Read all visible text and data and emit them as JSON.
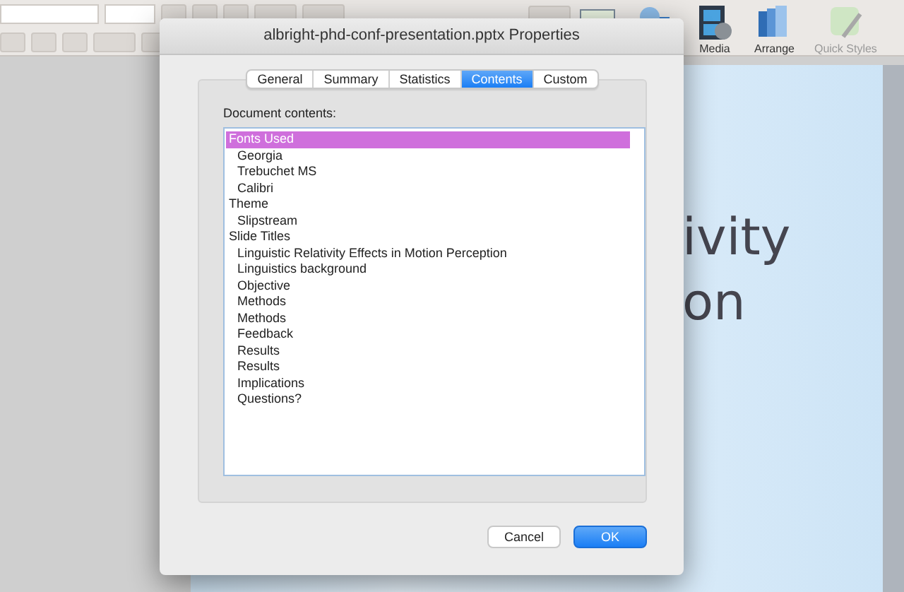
{
  "ribbon": {
    "buttons": [
      {
        "label": "Media",
        "kind": "media",
        "disabled": false
      },
      {
        "label": "Arrange",
        "kind": "arrange",
        "disabled": false
      },
      {
        "label": "Quick Styles",
        "kind": "styles",
        "disabled": true
      }
    ]
  },
  "slide": {
    "title_lines": [
      "ivity",
      "on"
    ]
  },
  "dialog": {
    "title": "albright-phd-conf-presentation.pptx Properties",
    "tabs": [
      {
        "label": "General",
        "selected": false
      },
      {
        "label": "Summary",
        "selected": false
      },
      {
        "label": "Statistics",
        "selected": false
      },
      {
        "label": "Contents",
        "selected": true
      },
      {
        "label": "Custom",
        "selected": false
      }
    ],
    "contents_label": "Document contents:",
    "tree": [
      {
        "label": "Fonts Used",
        "selected": true,
        "children": [
          {
            "label": "Georgia",
            "selected": false
          },
          {
            "label": "Trebuchet MS",
            "selected": false
          },
          {
            "label": "Calibri",
            "selected": false
          }
        ]
      },
      {
        "label": "Theme",
        "selected": false,
        "children": [
          {
            "label": "Slipstream",
            "selected": false
          }
        ]
      },
      {
        "label": "Slide Titles",
        "selected": false,
        "children": [
          {
            "label": "Linguistic Relativity Effects in Motion Perception",
            "selected": false
          },
          {
            "label": "Linguistics background",
            "selected": false
          },
          {
            "label": "Objective",
            "selected": false
          },
          {
            "label": "Methods",
            "selected": false
          },
          {
            "label": "Methods",
            "selected": false
          },
          {
            "label": "Feedback",
            "selected": false
          },
          {
            "label": "Results",
            "selected": false
          },
          {
            "label": "Results",
            "selected": false
          },
          {
            "label": "Implications",
            "selected": false
          },
          {
            "label": "Questions?",
            "selected": false
          }
        ]
      }
    ],
    "buttons": [
      {
        "label": "Cancel",
        "kind": "cancel"
      },
      {
        "label": "OK",
        "kind": "default"
      }
    ]
  }
}
